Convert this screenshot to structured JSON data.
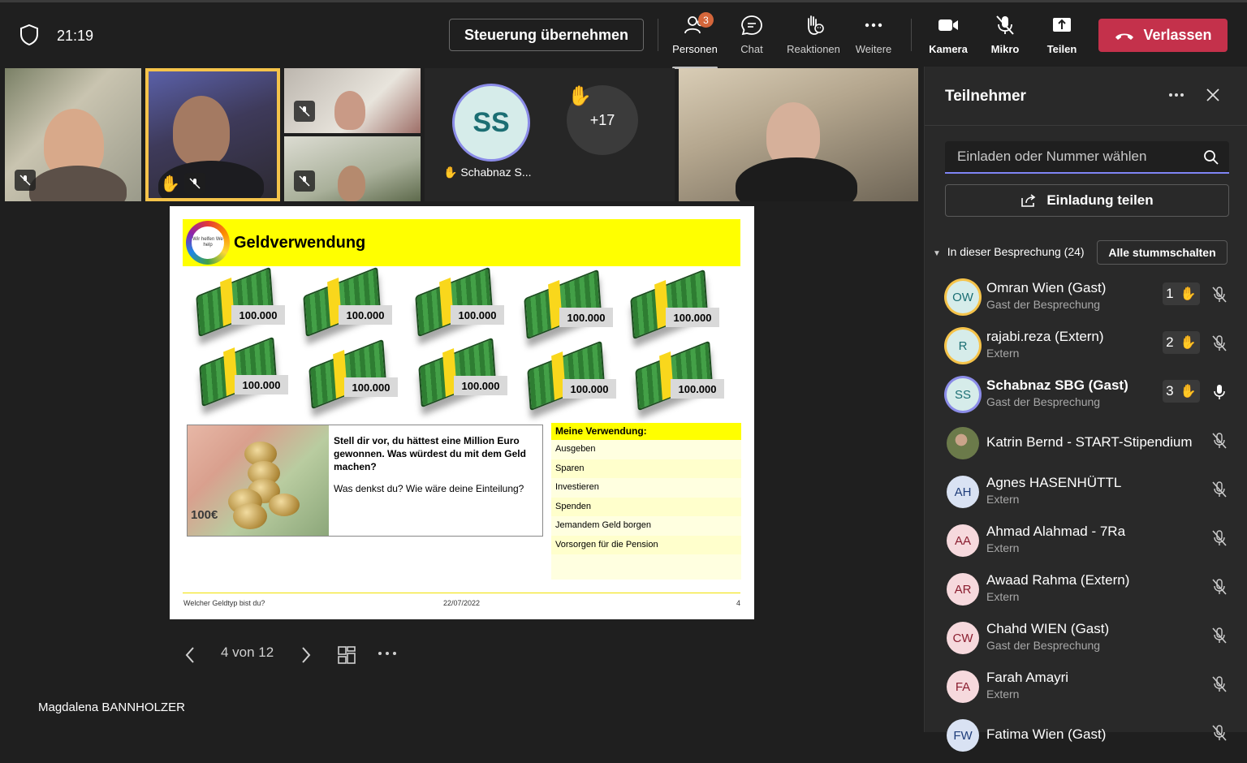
{
  "topbar": {
    "time": "21:19",
    "take_control": "Steuerung übernehmen",
    "people_label": "Personen",
    "people_badge": "3",
    "chat_label": "Chat",
    "reactions_label": "Reaktionen",
    "more_label": "Weitere",
    "camera_label": "Kamera",
    "mic_label": "Mikro",
    "share_label": "Teilen",
    "leave_label": "Verlassen",
    "leave_color": "#c4314b"
  },
  "videos": {
    "ss_initials": "SS",
    "ss_name": "Schabnaz S...",
    "overflow": "+17"
  },
  "slide": {
    "title": "Geldverwendung",
    "logo_text": "Wir helfen We help",
    "amounts": [
      "100.000",
      "100.000",
      "100.000",
      "100.000",
      "100.000",
      "100.000",
      "100.000",
      "100.000",
      "100.000",
      "100.000"
    ],
    "question": "Stell dir vor, du hättest eine Million Euro gewonnen. Was würdest du mit dem Geld machen?",
    "prompt": "Was denkst du? Wie wäre deine Einteilung?",
    "list_header": "Meine Verwendung:",
    "list_items": [
      "Ausgeben",
      "Sparen",
      "Investieren",
      "Spenden",
      "Jemandem Geld borgen",
      "Vorsorgen für die Pension"
    ],
    "footer_left": "Welcher Geldtyp bist du?",
    "footer_date": "22/07/2022",
    "footer_page": "4",
    "image_banknote": "100€"
  },
  "slide_nav": {
    "page_indicator": "4 von 12"
  },
  "presenter_name": "Magdalena BANNHOLZER",
  "panel": {
    "title": "Teilnehmer",
    "search_placeholder": "Einladen oder Nummer wählen",
    "invite_label": "Einladung teilen",
    "section_label": "In dieser Besprechung (24)",
    "mute_all": "Alle stummschalten",
    "participants": [
      {
        "initials": "OW",
        "name": "Omran Wien (Gast)",
        "sub": "Gast der Besprechung",
        "hand": "1",
        "av_bg": "#d6ecea",
        "av_fg": "#1b6e73"
      },
      {
        "initials": "R",
        "name": "rajabi.reza (Extern)",
        "sub": "Extern",
        "hand": "2",
        "av_bg": "#d6ecea",
        "av_fg": "#1b6e73"
      },
      {
        "initials": "SS",
        "name": "Schabnaz SBG (Gast)",
        "sub": "Gast der Besprechung",
        "hand": "3",
        "av_bg": "#d6ecea",
        "av_fg": "#1b6e73"
      },
      {
        "initials": "",
        "name": "Katrin Bernd - START-Stipendium",
        "sub": "",
        "hand": "",
        "av_bg": "#6b7a4a",
        "av_fg": "#ffffff"
      },
      {
        "initials": "AH",
        "name": "Agnes HASENHÜTTL",
        "sub": "Extern",
        "hand": "",
        "av_bg": "#d9e2f3",
        "av_fg": "#1f3d7a"
      },
      {
        "initials": "AA",
        "name": "Ahmad Alahmad - 7Ra",
        "sub": "Extern",
        "hand": "",
        "av_bg": "#f6d9dd",
        "av_fg": "#8a1d2f"
      },
      {
        "initials": "AR",
        "name": "Awaad Rahma (Extern)",
        "sub": "Extern",
        "hand": "",
        "av_bg": "#f6d9dd",
        "av_fg": "#8a1d2f"
      },
      {
        "initials": "CW",
        "name": "Chahd WIEN (Gast)",
        "sub": "Gast der Besprechung",
        "hand": "",
        "av_bg": "#f6d9dd",
        "av_fg": "#8a1d2f"
      },
      {
        "initials": "FA",
        "name": "Farah Amayri",
        "sub": "Extern",
        "hand": "",
        "av_bg": "#f6d9dd",
        "av_fg": "#8a1d2f"
      },
      {
        "initials": "FW",
        "name": "Fatima Wien (Gast)",
        "sub": "",
        "hand": "",
        "av_bg": "#d9e2f3",
        "av_fg": "#1f3d7a"
      }
    ]
  }
}
